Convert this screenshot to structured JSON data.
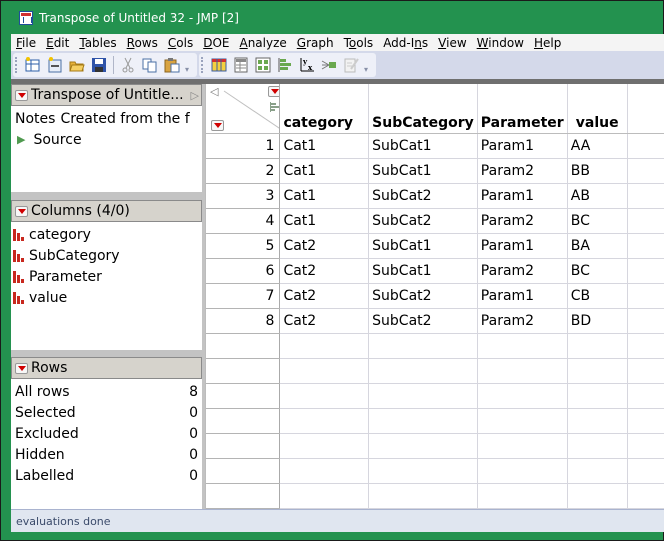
{
  "window": {
    "title": "Transpose of Untitled 32 - JMP [2]",
    "frame_color": "#23924F"
  },
  "menu": [
    {
      "label": "File",
      "mnemonic": "F",
      "rest": "ile"
    },
    {
      "label": "Edit",
      "mnemonic": "E",
      "rest": "dit"
    },
    {
      "label": "Tables",
      "mnemonic": "T",
      "rest": "ables"
    },
    {
      "label": "Rows",
      "mnemonic": "R",
      "rest": "ows"
    },
    {
      "label": "Cols",
      "mnemonic": "C",
      "rest": "ols"
    },
    {
      "label": "DOE",
      "mnemonic": "D",
      "rest": "OE"
    },
    {
      "label": "Analyze",
      "mnemonic": "A",
      "rest": "nalyze"
    },
    {
      "label": "Graph",
      "mnemonic": "G",
      "rest": "raph"
    },
    {
      "label": "Tools",
      "pre": "T",
      "mnemonic": "o",
      "rest": "ols"
    },
    {
      "label": "Add-Ins",
      "pre": "Add-I",
      "mnemonic": "n",
      "rest": "s"
    },
    {
      "label": "View",
      "mnemonic": "V",
      "rest": "iew"
    },
    {
      "label": "Window",
      "mnemonic": "W",
      "rest": "indow"
    },
    {
      "label": "Help",
      "mnemonic": "H",
      "rest": "elp"
    }
  ],
  "toolbar": {
    "group1": [
      "new-data-table-icon",
      "new-script-icon",
      "open-folder-icon",
      "save-icon",
      "cut-icon",
      "copy-icon",
      "paste-icon"
    ],
    "group2": [
      "data-table-icon",
      "tabulate-icon",
      "graph-builder-icon",
      "distribution-icon",
      "fit-y-by-x-icon",
      "fit-model-icon",
      "journal-edit-icon"
    ]
  },
  "table_panel": {
    "title": "Transpose of Untitle...",
    "notes_label": "Notes",
    "notes_value": "Created from the f",
    "source_label": "Source"
  },
  "columns_panel": {
    "title": "Columns (4/0)",
    "columns": [
      "category",
      "SubCategory",
      "Parameter",
      "value"
    ]
  },
  "rows_panel": {
    "title": "Rows",
    "stats": [
      {
        "label": "All rows",
        "value": "8"
      },
      {
        "label": "Selected",
        "value": "0"
      },
      {
        "label": "Excluded",
        "value": "0"
      },
      {
        "label": "Hidden",
        "value": "0"
      },
      {
        "label": "Labelled",
        "value": "0"
      }
    ]
  },
  "grid": {
    "headers": [
      "category",
      "SubCategory",
      "Parameter",
      "value"
    ],
    "rows": [
      {
        "n": "1",
        "cells": [
          "Cat1",
          "SubCat1",
          "Param1",
          "AA"
        ]
      },
      {
        "n": "2",
        "cells": [
          "Cat1",
          "SubCat1",
          "Param2",
          "BB"
        ]
      },
      {
        "n": "3",
        "cells": [
          "Cat1",
          "SubCat2",
          "Param1",
          "AB"
        ]
      },
      {
        "n": "4",
        "cells": [
          "Cat1",
          "SubCat2",
          "Param2",
          "BC"
        ]
      },
      {
        "n": "5",
        "cells": [
          "Cat2",
          "SubCat1",
          "Param1",
          "BA"
        ]
      },
      {
        "n": "6",
        "cells": [
          "Cat2",
          "SubCat1",
          "Param2",
          "BC"
        ]
      },
      {
        "n": "7",
        "cells": [
          "Cat2",
          "SubCat2",
          "Param1",
          "CB"
        ]
      },
      {
        "n": "8",
        "cells": [
          "Cat2",
          "SubCat2",
          "Param2",
          "BD"
        ]
      }
    ],
    "empty_rows": 7
  },
  "status": {
    "text": "evaluations done"
  }
}
